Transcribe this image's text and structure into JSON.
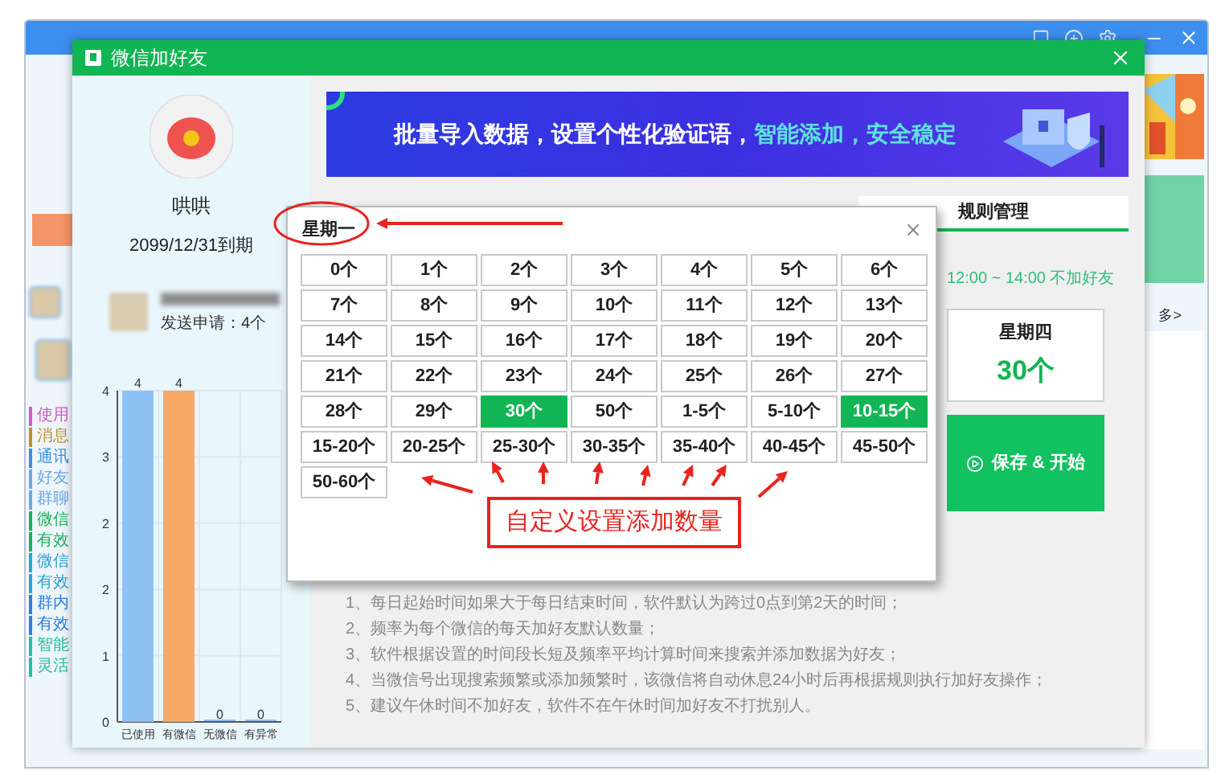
{
  "app": {
    "sidebar": [
      {
        "label": "使用",
        "color": "#d05ac8"
      },
      {
        "label": "消息",
        "color": "#c0902a"
      },
      {
        "label": "通讯",
        "color": "#3b8fe0"
      },
      {
        "label": "好友",
        "color": "#6aa8e8"
      },
      {
        "label": "群聊",
        "color": "#6aa8e8"
      },
      {
        "label": "微信",
        "color": "#19b35a"
      },
      {
        "label": "有效",
        "color": "#19b35a"
      },
      {
        "label": "微信",
        "color": "#2aa4d8"
      },
      {
        "label": "有效",
        "color": "#2aa4d8"
      },
      {
        "label": "群内",
        "color": "#2a7fe0"
      },
      {
        "label": "有效",
        "color": "#2a7fe0"
      },
      {
        "label": "智能",
        "color": "#22c0a0"
      },
      {
        "label": "灵活",
        "color": "#22c0a0"
      }
    ],
    "more_link": "多>"
  },
  "dialog": {
    "title": "微信加好友",
    "user": {
      "name": "哄哄",
      "expiry": "2099/12/31到期",
      "account_status": "发送申请：4个"
    },
    "chart_data": {
      "type": "bar",
      "categories": [
        "已使用",
        "有微信",
        "无微信",
        "有异常"
      ],
      "values": [
        4,
        4,
        0,
        0
      ],
      "ylim": [
        0,
        4
      ],
      "yticks": [
        0,
        {
          "value": 0.8,
          "label": "1"
        },
        {
          "value": 1.6,
          "label": "2"
        },
        {
          "value": 2.4,
          "label": "2"
        },
        {
          "value": 3.2,
          "label": "3"
        },
        4
      ],
      "data_labels": true,
      "grid": true,
      "colors": [
        "#8fc1f5",
        "#f9a866",
        "#8fc1f5",
        "#8fc1f5"
      ]
    },
    "banner": {
      "text": "批量导入数据，设置个性化验证语，",
      "highlight": "智能添加，安全稳定"
    },
    "tabs": [
      {
        "label": "规则管理",
        "selected": true
      }
    ],
    "quiet_hours": "12:00 ~ 14:00 不加好友",
    "day_card": {
      "day": "星期四",
      "count": "30个"
    },
    "save_button": "保存 & 开始",
    "notes": [
      "1、每日起始时间如果大于每日结束时间，软件默认为跨过0点到第2天的时间；",
      "2、频率为每个微信的每天加好友默认数量；",
      "3、软件根据设置的时间段长短及频率平均计算时间来搜索并添加数据为好友；",
      "4、当微信号出现搜索频繁或添加频繁时，该微信将自动休息24小时后再根据规则执行加好友操作；",
      "5、建议午休时间不加好友，软件不在午休时间加好友不打扰别人。"
    ]
  },
  "popup": {
    "title": "星期一",
    "options": [
      {
        "label": "0个",
        "selected": false
      },
      {
        "label": "1个",
        "selected": false
      },
      {
        "label": "2个",
        "selected": false
      },
      {
        "label": "3个",
        "selected": false
      },
      {
        "label": "4个",
        "selected": false
      },
      {
        "label": "5个",
        "selected": false
      },
      {
        "label": "6个",
        "selected": false
      },
      {
        "label": "7个",
        "selected": false
      },
      {
        "label": "8个",
        "selected": false
      },
      {
        "label": "9个",
        "selected": false
      },
      {
        "label": "10个",
        "selected": false
      },
      {
        "label": "11个",
        "selected": false
      },
      {
        "label": "12个",
        "selected": false
      },
      {
        "label": "13个",
        "selected": false
      },
      {
        "label": "14个",
        "selected": false
      },
      {
        "label": "15个",
        "selected": false
      },
      {
        "label": "16个",
        "selected": false
      },
      {
        "label": "17个",
        "selected": false
      },
      {
        "label": "18个",
        "selected": false
      },
      {
        "label": "19个",
        "selected": false
      },
      {
        "label": "20个",
        "selected": false
      },
      {
        "label": "21个",
        "selected": false
      },
      {
        "label": "22个",
        "selected": false
      },
      {
        "label": "23个",
        "selected": false
      },
      {
        "label": "24个",
        "selected": false
      },
      {
        "label": "25个",
        "selected": false
      },
      {
        "label": "26个",
        "selected": false
      },
      {
        "label": "27个",
        "selected": false
      },
      {
        "label": "28个",
        "selected": false
      },
      {
        "label": "29个",
        "selected": false
      },
      {
        "label": "30个",
        "selected": true
      },
      {
        "label": "50个",
        "selected": false
      },
      {
        "label": "1-5个",
        "selected": false
      },
      {
        "label": "5-10个",
        "selected": false
      },
      {
        "label": "10-15个",
        "selected": true
      },
      {
        "label": "15-20个",
        "selected": false
      },
      {
        "label": "20-25个",
        "selected": false
      },
      {
        "label": "25-30个",
        "selected": false
      },
      {
        "label": "30-35个",
        "selected": false
      },
      {
        "label": "35-40个",
        "selected": false
      },
      {
        "label": "40-45个",
        "selected": false
      },
      {
        "label": "45-50个",
        "selected": false
      },
      {
        "label": "50-60个",
        "selected": false
      }
    ]
  },
  "annotation": "自定义设置添加数量"
}
